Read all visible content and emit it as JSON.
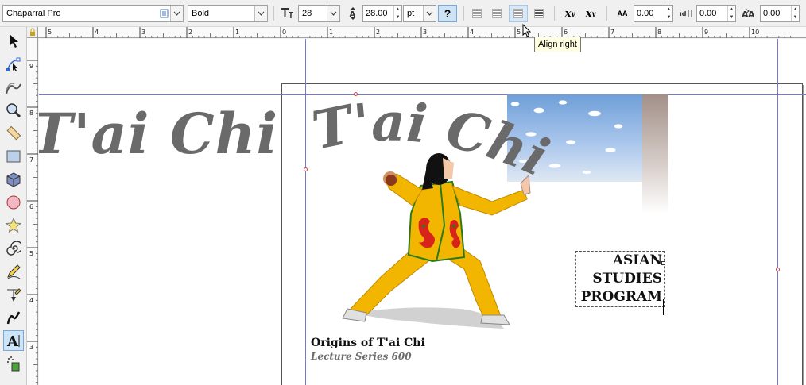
{
  "toolbar": {
    "font_family": "Chaparral Pro",
    "font_style": "Bold",
    "font_size": "28",
    "line_spacing": "28.00",
    "unit": "pt",
    "help_label": "?",
    "superscript_label": "x",
    "subscript_label": "x",
    "letter_spacing": "0.00",
    "word_spacing": "0.00",
    "kerning": "0.00",
    "aa_label": "AA"
  },
  "tooltip": {
    "text": "Align right"
  },
  "ruler": {
    "h_labels": [
      "5",
      "4",
      "3",
      "2",
      "1",
      "0",
      "1",
      "2",
      "3",
      "4",
      "5",
      "6",
      "7",
      "8",
      "9",
      "10"
    ],
    "v_labels": [
      "9",
      "8",
      "7",
      "6",
      "5",
      "4",
      "3"
    ]
  },
  "tools": [
    "selector-icon",
    "node-icon",
    "tweak-icon",
    "zoom-icon",
    "measure-icon",
    "rectangle-icon",
    "3d-box-icon",
    "ellipse-icon",
    "star-icon",
    "spiral-icon",
    "pencil-icon",
    "pen-icon",
    "calligraphy-icon",
    "text-icon",
    "spray-icon"
  ],
  "canvas": {
    "left_title": "T'ai Chi",
    "arc_title": "T'ai Chi",
    "asian_lines": [
      "ASIAN",
      "STUDIES",
      "PROGRAM"
    ],
    "origins_title": "Origins of T'ai Chi",
    "origins_subtitle": "Lecture Series 600"
  },
  "colors": {
    "suit": "#f2b600",
    "suit_trim": "#2a7a1a",
    "dragon": "#d8231a",
    "title_gray": "#6a6a6a",
    "guide": "#7777cc"
  }
}
